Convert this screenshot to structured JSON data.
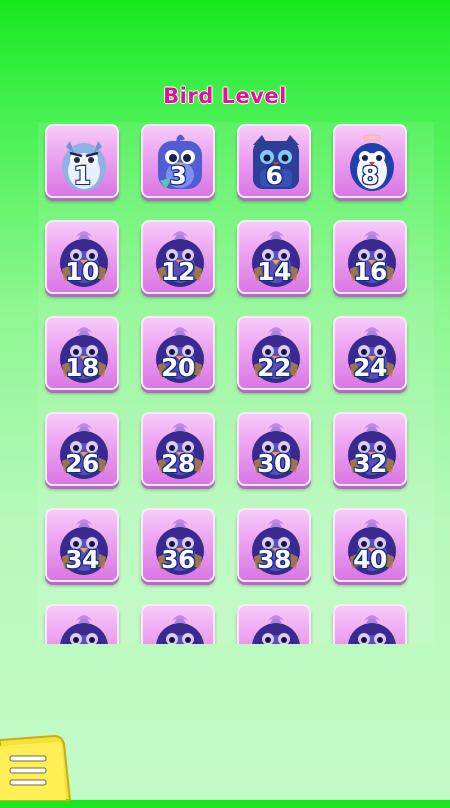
{
  "title": "Bird Level",
  "levels": [
    {
      "number": "1",
      "bird": "white-owl-icon"
    },
    {
      "number": "3",
      "bird": "blue-bird-icon"
    },
    {
      "number": "6",
      "bird": "dark-owl-icon"
    },
    {
      "number": "8",
      "bird": "penguin-icon"
    },
    {
      "number": "10",
      "bird": "locked-bird-icon"
    },
    {
      "number": "12",
      "bird": "locked-bird-icon"
    },
    {
      "number": "14",
      "bird": "locked-bird-icon"
    },
    {
      "number": "16",
      "bird": "locked-bird-icon"
    },
    {
      "number": "18",
      "bird": "locked-bird-icon"
    },
    {
      "number": "20",
      "bird": "locked-bird-icon"
    },
    {
      "number": "22",
      "bird": "locked-bird-icon"
    },
    {
      "number": "24",
      "bird": "locked-bird-icon"
    },
    {
      "number": "26",
      "bird": "locked-bird-icon"
    },
    {
      "number": "28",
      "bird": "locked-bird-icon"
    },
    {
      "number": "30",
      "bird": "locked-bird-icon"
    },
    {
      "number": "32",
      "bird": "locked-bird-icon"
    },
    {
      "number": "34",
      "bird": "locked-bird-icon"
    },
    {
      "number": "36",
      "bird": "locked-bird-icon"
    },
    {
      "number": "38",
      "bird": "locked-bird-icon"
    },
    {
      "number": "40",
      "bird": "locked-bird-icon"
    },
    {
      "number": "",
      "bird": "locked-bird-icon"
    },
    {
      "number": "",
      "bird": "locked-bird-icon"
    },
    {
      "number": "",
      "bird": "locked-bird-icon"
    },
    {
      "number": "",
      "bird": "locked-bird-icon"
    }
  ],
  "menu": {
    "icon": "hamburger-menu-icon"
  },
  "colors": {
    "title": "#e0119a",
    "tile": "#e99cf0",
    "bg_top": "#17e81f",
    "bg_bottom": "#c3fbc7"
  }
}
